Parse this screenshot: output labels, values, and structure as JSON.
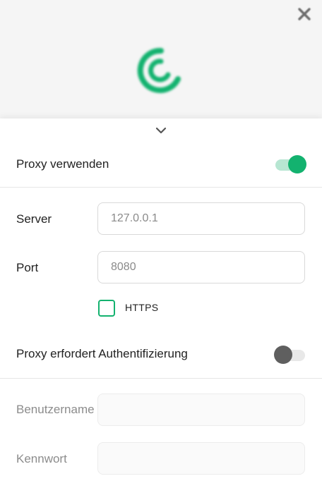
{
  "header": {
    "close_icon": "close-icon",
    "logo_icon": "logo-icon",
    "accent_color": "#13b26f"
  },
  "sheet": {
    "collapse_icon": "chevron-down-icon"
  },
  "proxy": {
    "use_proxy_label": "Proxy verwenden",
    "use_proxy_enabled": true,
    "server_label": "Server",
    "server_placeholder": "127.0.0.1",
    "port_label": "Port",
    "port_placeholder": "8080",
    "https_label": "HTTPS",
    "https_checked": false,
    "auth_label": "Proxy erfordert Authentifizierung",
    "auth_enabled": false,
    "username_label": "Benutzername",
    "username_value": "",
    "password_label": "Kennwort",
    "password_value": ""
  }
}
